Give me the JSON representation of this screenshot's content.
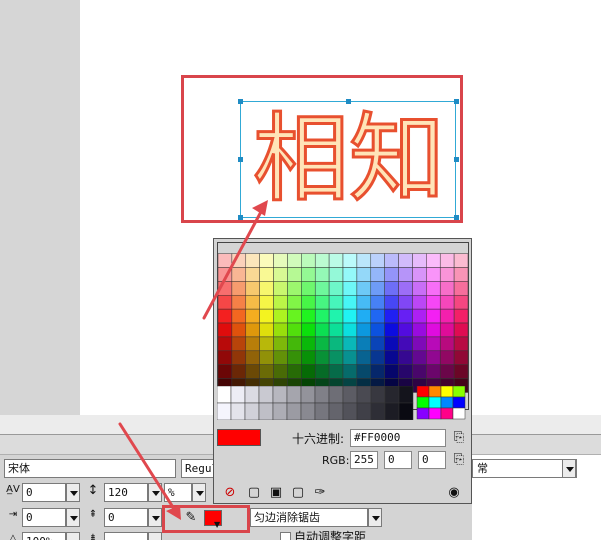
{
  "canvas": {
    "text_object": "相知"
  },
  "palette": {
    "hex_label": "十六进制:",
    "hex_value": "#FF0000",
    "rgb_label": "RGB:",
    "rgb_r": "255",
    "rgb_g": "0",
    "rgb_b": "0",
    "preview_color": "#ff0000",
    "quick_colors": [
      "#ff0000",
      "#ff8800",
      "#ffff00",
      "#88ff00",
      "#00ff00",
      "#00ffff",
      "#0088ff",
      "#0000ff",
      "#8800ff",
      "#ff00ff",
      "#ff0088",
      "#ffffff"
    ]
  },
  "property_bar": {
    "font_family": "宋体",
    "font_style": "Regul",
    "tracking": "0",
    "leading": "120",
    "leading_unit": "%",
    "indent": "0",
    "space_before": "0",
    "zoom": "100%",
    "antialias": "匀边消除锯齿",
    "auto_kern": "自动调整字距",
    "right_dropdown": "常",
    "fill_color": "#ff0000"
  },
  "icons": {
    "tracking": "tracking-icon",
    "leading": "leading-icon",
    "indent": "indent-icon",
    "space_before": "space-before-icon",
    "pencil": "pencil-icon",
    "copy": "copy-icon",
    "color_wheel": "color-wheel-icon",
    "no_color": "no-color-icon"
  }
}
